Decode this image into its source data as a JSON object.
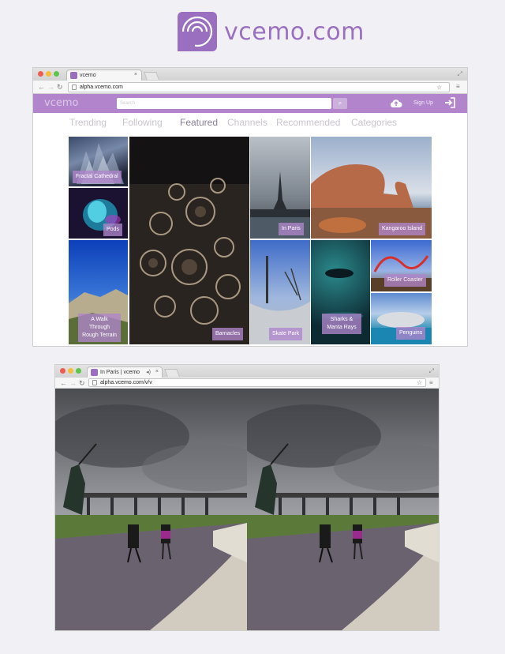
{
  "logo": {
    "text": "vcemo.com"
  },
  "browser1": {
    "tab_title": "vcemo",
    "url": "alpha.vcemo.com",
    "site": {
      "logo_text": "vcemo",
      "search_placeholder": "Search",
      "signup_label": "Sign Up",
      "nav": [
        "Trending",
        "Following",
        "Featured",
        "Channels",
        "Recommended",
        "Categories"
      ],
      "active_nav": "Featured"
    },
    "tiles": [
      {
        "label": "Fractal Cathedral"
      },
      {
        "label": "Pods"
      },
      {
        "label": "A Walk Through Rough Terrain"
      },
      {
        "label": "Barnacles"
      },
      {
        "label": "In Paris"
      },
      {
        "label": "Kangaroo Island"
      },
      {
        "label": "Skate Park"
      },
      {
        "label": "Sharks & Manta Rays"
      },
      {
        "label": "Roller Coaster"
      },
      {
        "label": "Penguins"
      }
    ]
  },
  "browser2": {
    "tab_title": "In Paris | vcemo",
    "url": "alpha.vcemo.com/v/v"
  },
  "colors": {
    "brand": "#b184cc",
    "logo": "#9a6fc0"
  },
  "icons": [
    "vcemo-logo-icon",
    "upload-cloud-icon",
    "login-icon",
    "search-icon",
    "back-arrow-icon",
    "forward-arrow-icon",
    "reload-icon",
    "menu-icon",
    "star-icon"
  ]
}
